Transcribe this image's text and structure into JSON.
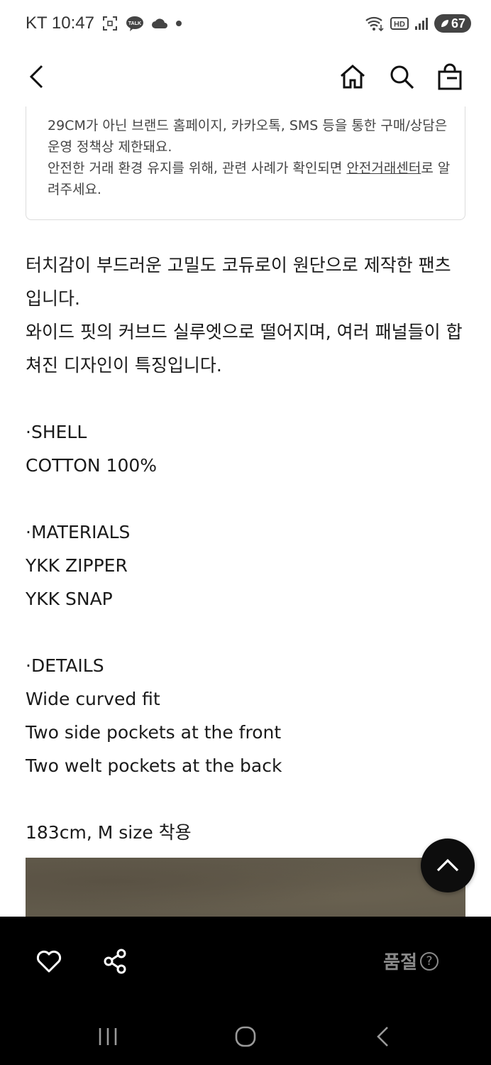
{
  "status_bar": {
    "carrier": "KT",
    "time": "10:47",
    "battery": "67",
    "hd_label": "HD",
    "talk_label": "TALK"
  },
  "header": {
    "icons": [
      "back-icon",
      "home-icon",
      "search-icon",
      "shopping-bag-icon"
    ]
  },
  "notice": {
    "line1": "29CM가 아닌 브랜드 홈페이지, 카카오톡, SMS 등을 통한 구매/상담은 운영 정책상 제한돼요.",
    "line2_prefix": "안전한 거래 환경 유지를 위해, 관련 사례가 확인되면 ",
    "line2_link": "안전거래센터",
    "line2_suffix": "로 알려주세요."
  },
  "description": {
    "intro1": "터치감이 부드러운 고밀도 코듀로이 원단으로 제작한 팬츠입니다.",
    "intro2": "와이드 핏의 커브드 실루엣으로 떨어지며, 여러 패널들이 합쳐진 디자인이 특징입니다.",
    "shell_heading": "·SHELL",
    "shell_value": "COTTON 100%",
    "materials_heading": "·MATERIALS",
    "material1": "YKK ZIPPER",
    "material2": "YKK SNAP",
    "details_heading": "·DETAILS",
    "detail1": "Wide curved fit",
    "detail2": "Two side pockets at the front",
    "detail3": "Two welt pockets at the back",
    "model_info": "183cm, M size 착용"
  },
  "bottom_bar": {
    "soldout_label": "품절",
    "help_symbol": "?"
  },
  "colors": {
    "bottom_bar_bg": "#000000",
    "text_primary": "#1a1a1a",
    "text_muted": "#8a8a8a"
  }
}
